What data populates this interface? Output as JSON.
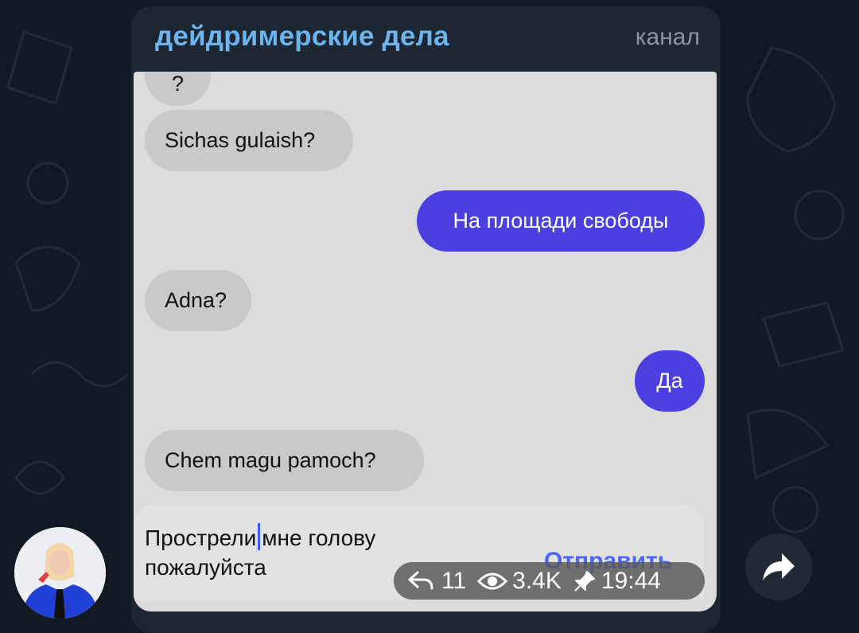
{
  "channel": {
    "title": "дейдримерские дела",
    "type": "канал"
  },
  "chat": {
    "partial_top": "?",
    "messages": [
      {
        "dir": "in",
        "text": "Sichas gulaish?"
      },
      {
        "dir": "out",
        "text": "На площади свободы"
      },
      {
        "dir": "in",
        "text": "Adna?"
      },
      {
        "dir": "out",
        "text": "Да"
      },
      {
        "dir": "in",
        "text": "Chem magu pamoch?"
      }
    ],
    "compose": {
      "text_before_caret": "Прострели",
      "text_after_caret": "мне голову",
      "text_line2": "пожалуйста",
      "send_label": "Отправить"
    }
  },
  "post_meta": {
    "replies": "11",
    "views": "3.4K",
    "time": "19:44"
  },
  "colors": {
    "accent": "#6cb4ee",
    "outgoing": "#4b3fe0",
    "send": "#4b66ff"
  },
  "icons": [
    "reply-icon",
    "eye-icon",
    "pin-icon",
    "share-arrow-icon"
  ]
}
